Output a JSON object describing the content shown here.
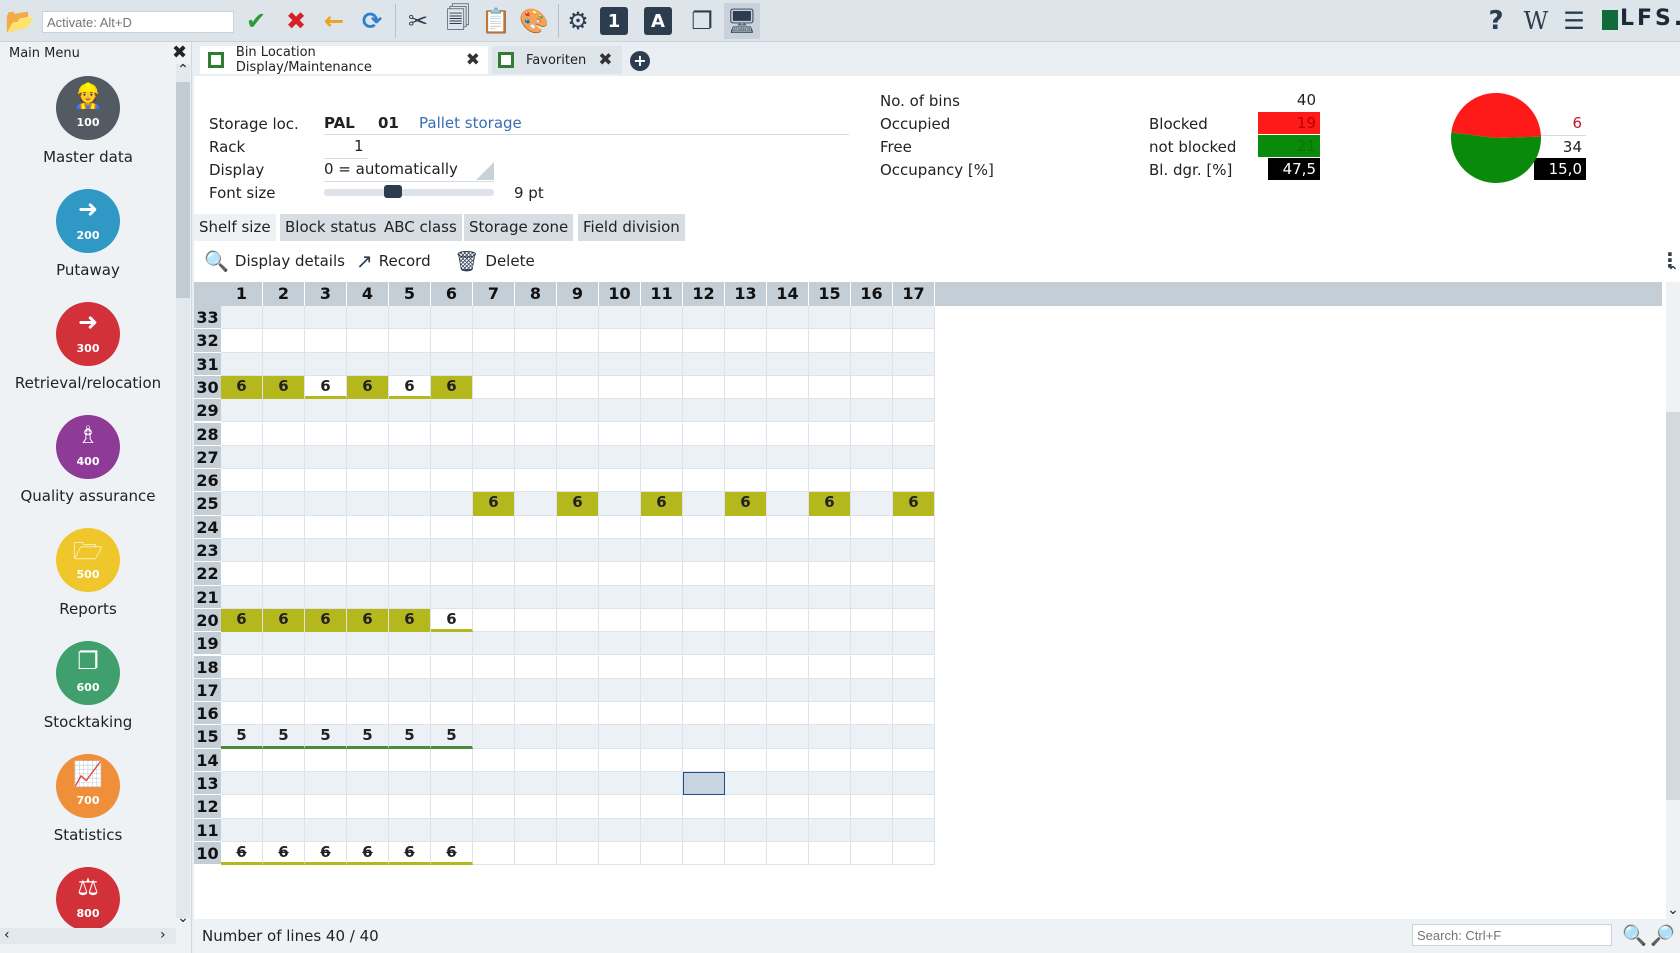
{
  "toolbar": {
    "activate_placeholder": "Activate: Alt+D",
    "logo_text": "LFS."
  },
  "sidebar": {
    "title": "Main Menu",
    "items": [
      {
        "num": "100",
        "label": "Master data",
        "color": "#545a61"
      },
      {
        "num": "200",
        "label": "Putaway",
        "color": "#2f98c5"
      },
      {
        "num": "300",
        "label": "Retrieval/relocation",
        "color": "#d3313a"
      },
      {
        "num": "400",
        "label": "Quality assurance",
        "color": "#8e3b97"
      },
      {
        "num": "500",
        "label": "Reports",
        "color": "#efc62b"
      },
      {
        "num": "600",
        "label": "Stocktaking",
        "color": "#3fa06d"
      },
      {
        "num": "700",
        "label": "Statistics",
        "color": "#ef8f3a"
      },
      {
        "num": "800",
        "label": "",
        "color": "#d3313a"
      }
    ]
  },
  "tabs": [
    {
      "label": "Bin Location Display/Maintenance"
    },
    {
      "label": "Favoriten"
    }
  ],
  "form": {
    "storage_loc_label": "Storage loc.",
    "storage_loc_code": "PAL",
    "storage_loc_no": "01",
    "storage_loc_desc": "Pallet storage",
    "rack_label": "Rack",
    "rack_value": "1",
    "display_label": "Display",
    "display_value": "0 = automatically",
    "font_size_label": "Font size",
    "font_size_value": "9 pt",
    "font_size_slider": 0.4
  },
  "stats": {
    "no_of_bins_label": "No. of bins",
    "no_of_bins": "40",
    "occupied_label": "Occupied",
    "occupied": "19",
    "free_label": "Free",
    "free": "21",
    "occupancy_label": "Occupancy [%]",
    "occupancy": "47,5",
    "blocked_label": "Blocked",
    "blocked": "6",
    "not_blocked_label": "not blocked",
    "not_blocked": "34",
    "bl_dgr_label": "Bl. dgr. [%]",
    "bl_dgr": "15,0",
    "pie_occupied_pct": 47.5,
    "pie_colors": {
      "occupied": "#ff1a1a",
      "free": "#0a8a0a"
    }
  },
  "subtabs": [
    "Shelf size",
    "Block status",
    "ABC class",
    "Storage zone",
    "Field division"
  ],
  "actions": {
    "display_details": "Display details",
    "record": "Record",
    "delete": "Delete"
  },
  "grid": {
    "columns": [
      "1",
      "2",
      "3",
      "4",
      "5",
      "6",
      "7",
      "8",
      "9",
      "10",
      "11",
      "12",
      "13",
      "14",
      "15",
      "16",
      "17"
    ],
    "rows": [
      "33",
      "32",
      "31",
      "30",
      "29",
      "28",
      "27",
      "26",
      "25",
      "24",
      "23",
      "22",
      "21",
      "20",
      "19",
      "18",
      "17",
      "16",
      "15",
      "14",
      "13",
      "12",
      "11",
      "10"
    ],
    "cells": {
      "30": {
        "1": "6",
        "2": "6",
        "3": "6",
        "4": "6",
        "5": "6",
        "6": "6"
      },
      "25": {
        "7": "6",
        "9": "6",
        "11": "6",
        "13": "6",
        "15": "6",
        "17": "6"
      },
      "20": {
        "1": "6",
        "2": "6",
        "3": "6",
        "4": "6",
        "5": "6",
        "6": "6"
      },
      "15": {
        "1": "5",
        "2": "5",
        "3": "5",
        "4": "5",
        "5": "5",
        "6": "5"
      },
      "10": {
        "1": "6",
        "2": "6",
        "3": "6",
        "4": "6",
        "5": "6",
        "6": "6"
      }
    },
    "occupied_filled": {
      "30": [
        "1",
        "2",
        "4",
        "6"
      ],
      "25": [
        "7",
        "9",
        "11",
        "13",
        "15",
        "17"
      ],
      "20": [
        "1",
        "2",
        "3",
        "4",
        "5"
      ]
    },
    "blocked_row": "10",
    "selected": {
      "row": "13",
      "col": "12"
    }
  },
  "footer": {
    "count": "Number of lines 40 / 40",
    "search_placeholder": "Search: Ctrl+F"
  }
}
